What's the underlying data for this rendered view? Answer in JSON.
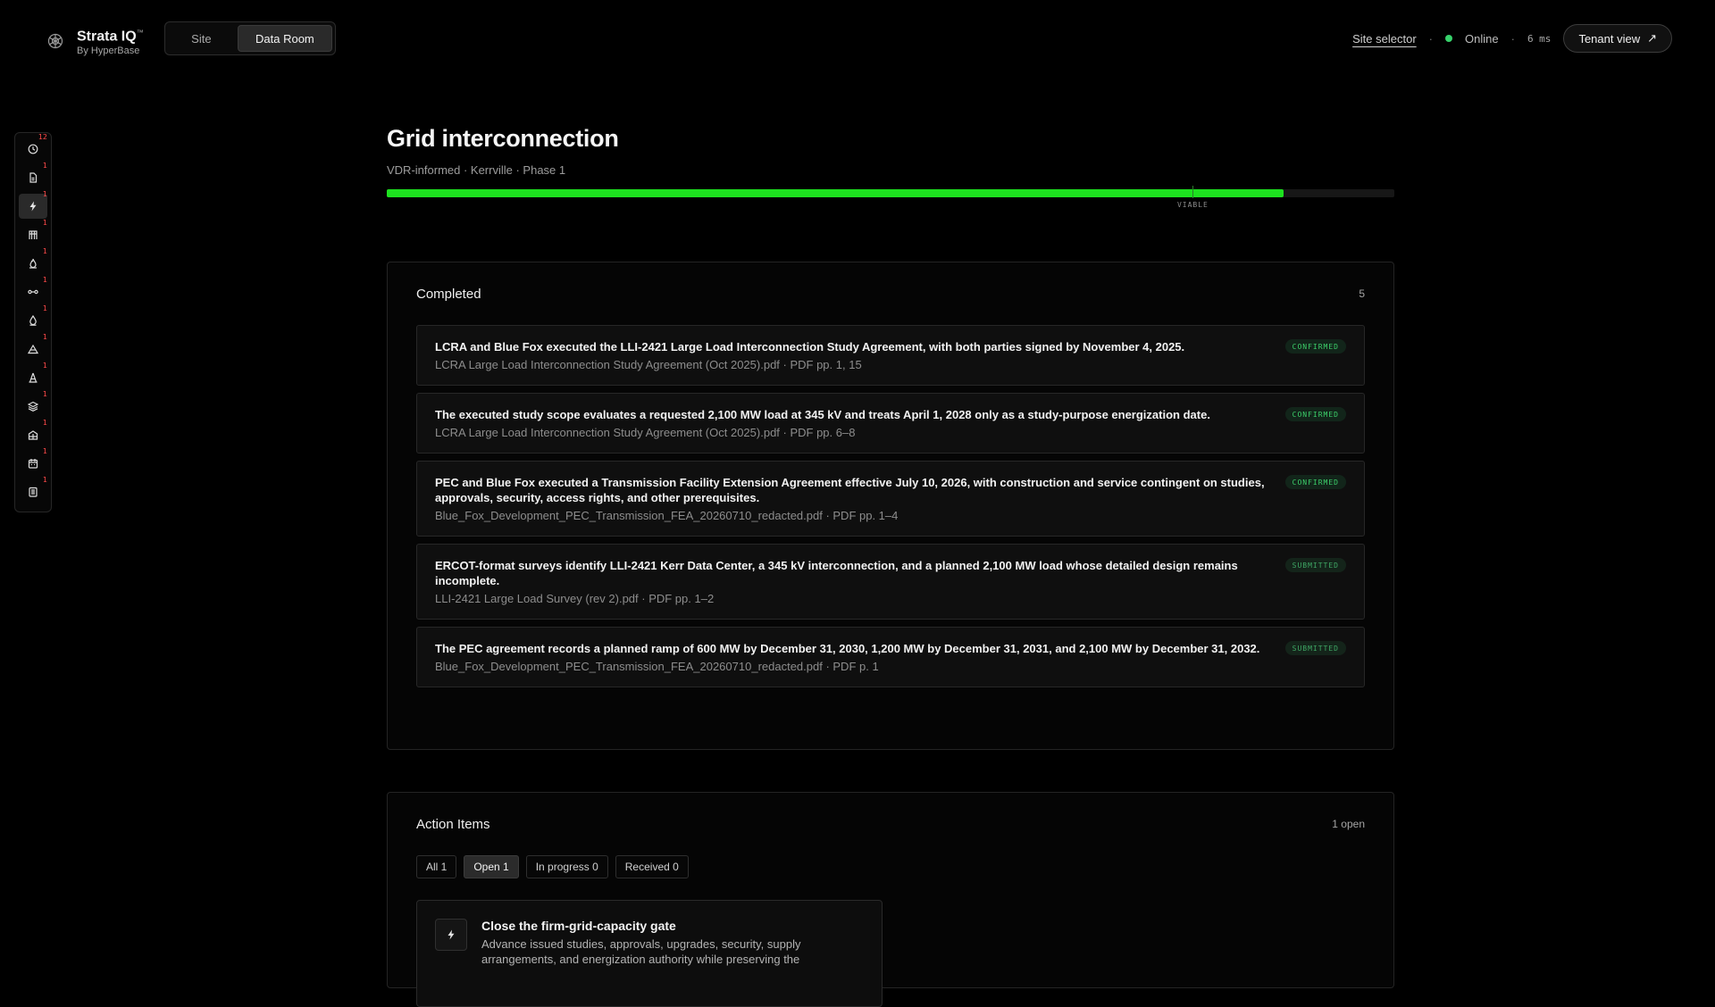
{
  "brand": {
    "name": "Strata IQ",
    "trademark": "™",
    "by": "By HyperBase"
  },
  "mode_toggle": {
    "site_label": "Site",
    "dataroom_label": "Data Room",
    "selected": "Data Room"
  },
  "status": {
    "site_selector": "Site selector",
    "sep": "·",
    "online_label": "Online",
    "latency": "6 ms",
    "tenant_label": "Tenant view",
    "tenant_arrow": "↗"
  },
  "rail": {
    "items": [
      {
        "icon": "clock-icon",
        "badge": "12"
      },
      {
        "icon": "document-icon",
        "badge": "1"
      },
      {
        "icon": "lightning-icon",
        "badge": "1",
        "active": true
      },
      {
        "icon": "tower-icon",
        "badge": "1"
      },
      {
        "icon": "flame-icon",
        "badge": "1"
      },
      {
        "icon": "connector-icon",
        "badge": "1"
      },
      {
        "icon": "droplet-icon",
        "badge": "1"
      },
      {
        "icon": "terrain-icon",
        "badge": "1"
      },
      {
        "icon": "pylon-icon",
        "badge": "1"
      },
      {
        "icon": "layers-icon",
        "badge": "1"
      },
      {
        "icon": "building-icon",
        "badge": "1"
      },
      {
        "icon": "calendar-icon",
        "badge": "1"
      },
      {
        "icon": "list-icon",
        "badge": "1"
      }
    ]
  },
  "page": {
    "title": "Grid interconnection",
    "subtitle": "VDR-informed · Kerrville · Phase 1",
    "progress": {
      "fraction": 0.89,
      "viable_threshold": 0.8,
      "viable_label": "VIABLE"
    }
  },
  "completed": {
    "title": "Completed",
    "count": "5",
    "items": [
      {
        "claim": "LCRA and Blue Fox executed the LLI-2421 Large Load Interconnection Study Agreement, with both parties signed by November 4, 2025.",
        "source": "LCRA Large Load Interconnection Study Agreement (Oct 2025).pdf · PDF pp. 1, 15",
        "status": "CONFIRMED"
      },
      {
        "claim": "The executed study scope evaluates a requested 2,100 MW load at 345 kV and treats April 1, 2028 only as a study-purpose energization date.",
        "source": "LCRA Large Load Interconnection Study Agreement (Oct 2025).pdf · PDF pp. 6–8",
        "status": "CONFIRMED"
      },
      {
        "claim": "PEC and Blue Fox executed a Transmission Facility Extension Agreement effective July 10, 2026, with construction and service contingent on studies, approvals, security, access rights, and other prerequisites.",
        "source": "Blue_Fox_Development_PEC_Transmission_FEA_20260710_redacted.pdf · PDF pp. 1–4",
        "status": "CONFIRMED"
      },
      {
        "claim": "ERCOT-format surveys identify LLI-2421 Kerr Data Center, a 345 kV interconnection, and a planned 2,100 MW load whose detailed design remains incomplete.",
        "source": "LLI-2421 Large Load Survey (rev 2).pdf · PDF pp. 1–2",
        "status": "SUBMITTED"
      },
      {
        "claim": "The PEC agreement records a planned ramp of 600 MW by December 31, 2030, 1,200 MW by December 31, 2031, and 2,100 MW by December 31, 2032.",
        "source": "Blue_Fox_Development_PEC_Transmission_FEA_20260710_redacted.pdf · PDF p. 1",
        "status": "SUBMITTED"
      }
    ]
  },
  "actions": {
    "title": "Action Items",
    "count": "1 open",
    "filters": [
      {
        "label": "All 1"
      },
      {
        "label": "Open 1",
        "active": true
      },
      {
        "label": "In progress 0"
      },
      {
        "label": "Received 0"
      }
    ],
    "card": {
      "icon": "lightning-icon",
      "title": "Close the firm-grid-capacity gate",
      "desc": "Advance issued studies, approvals, upgrades, security, supply arrangements, and energization authority while preserving the"
    }
  }
}
